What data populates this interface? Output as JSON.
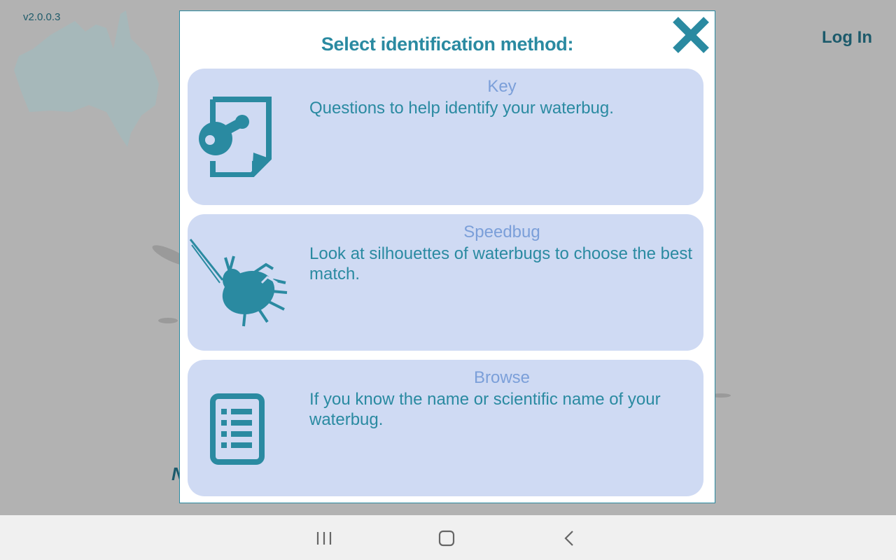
{
  "app": {
    "version": "v2.0.0.3",
    "login_label": "Log In"
  },
  "modal": {
    "title": "Select identification method:",
    "options": [
      {
        "title": "Key",
        "description": "Questions to help identify your waterbug.",
        "icon": "key-document-icon"
      },
      {
        "title": "Speedbug",
        "description": "Look at silhouettes of waterbugs to choose the best match.",
        "icon": "waterbug-silhouette-icon"
      },
      {
        "title": "Browse",
        "description": "If you know the name or scientific name of your waterbug.",
        "icon": "list-document-icon"
      }
    ]
  },
  "colors": {
    "accent": "#2a8aa1",
    "option_bg": "#cfdaf3",
    "option_title": "#7b9fd9",
    "background": "#b2b2b2"
  },
  "navbar": {
    "buttons": [
      "recent-apps-icon",
      "home-icon",
      "back-icon"
    ]
  }
}
